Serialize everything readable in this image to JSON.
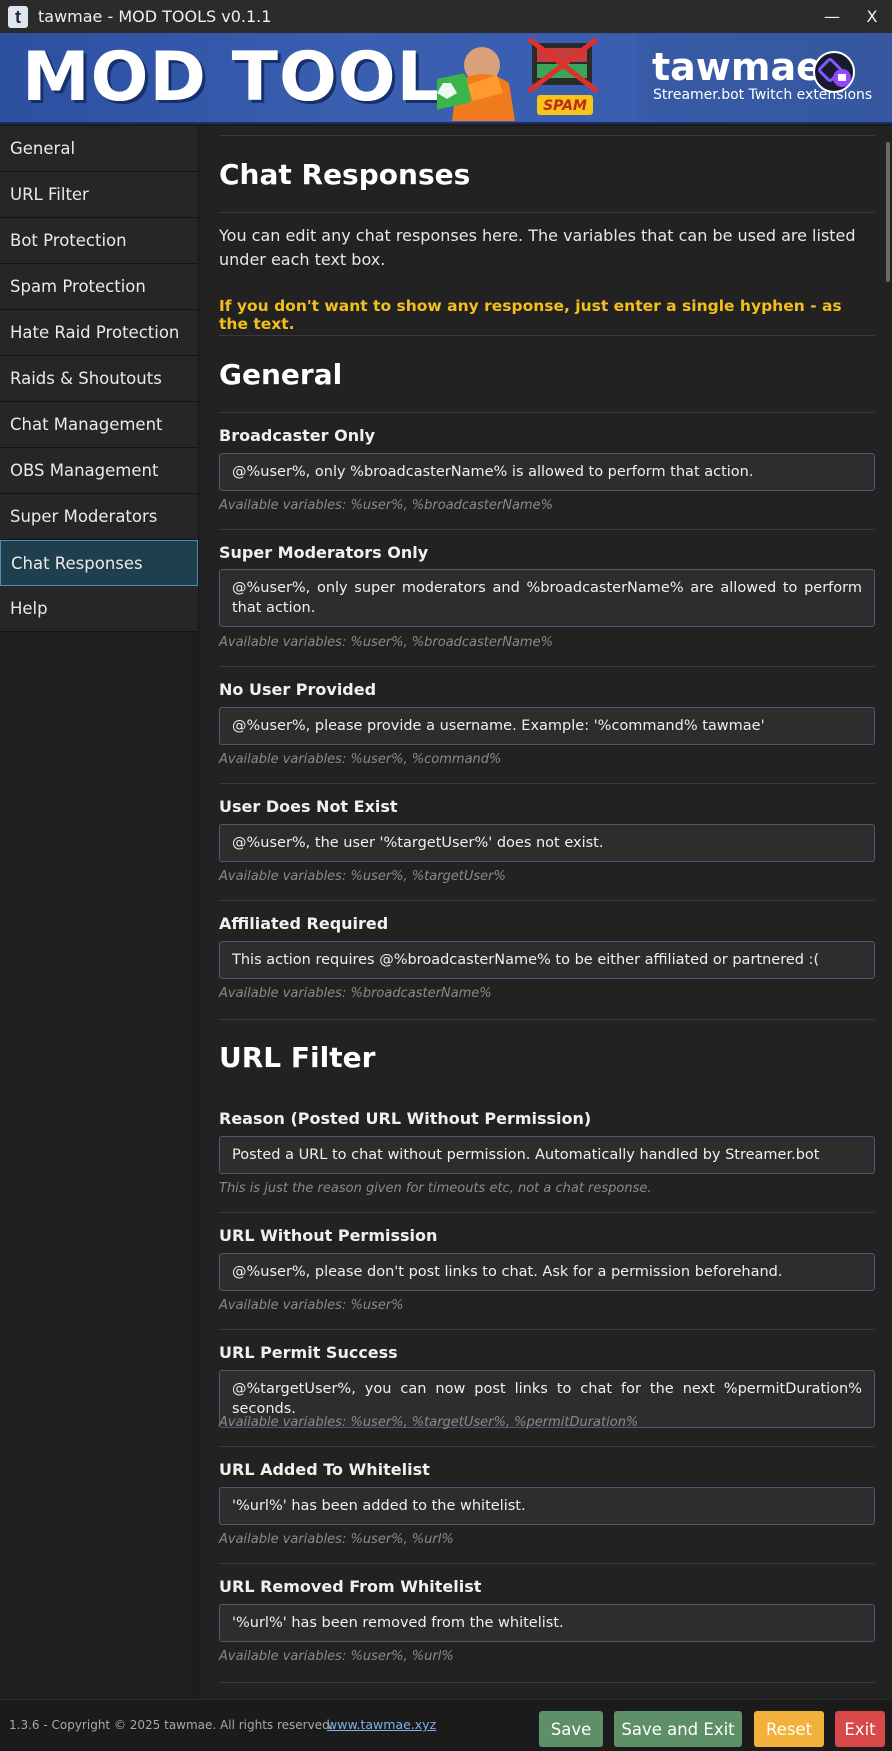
{
  "window": {
    "title": "tawmae - MOD TOOLS v0.1.1",
    "icon_letter": "t",
    "minimize_label": "—",
    "close_label": "X"
  },
  "banner": {
    "title": "MOD TOOLS",
    "brand": "tawmae",
    "subtitle": "Streamer.bot Twitch extensions",
    "art_caption": "SPAM",
    "art_icon": "meme-image-icon",
    "logo_icon": "tawmae-twitch-logo-icon"
  },
  "sidebar": {
    "items": [
      {
        "label": "General"
      },
      {
        "label": "URL Filter"
      },
      {
        "label": "Bot Protection"
      },
      {
        "label": "Spam Protection"
      },
      {
        "label": "Hate Raid Protection"
      },
      {
        "label": "Raids & Shoutouts"
      },
      {
        "label": "Chat Management"
      },
      {
        "label": "OBS Management"
      },
      {
        "label": "Super Moderators"
      },
      {
        "label": "Chat Responses"
      },
      {
        "label": "Help"
      }
    ],
    "active_index": 9
  },
  "page": {
    "title": "Chat Responses",
    "intro": "You can edit any chat responses here. The variables that can be used are listed under each text box.",
    "warning": "If you don't want to show any response, just enter a single hyphen - as the text."
  },
  "sections": {
    "general": {
      "heading": "General",
      "fields": [
        {
          "label": "Broadcaster Only",
          "value": "@%user%, only %broadcasterName% is allowed to perform that action.",
          "hint": "Available variables: %user%, %broadcasterName%"
        },
        {
          "label": "Super Moderators Only",
          "value": "@%user%, only super moderators and %broadcasterName% are allowed to perform that action.",
          "hint": "Available variables: %user%, %broadcasterName%"
        },
        {
          "label": "No User Provided",
          "value": "@%user%, please provide a username. Example: '%command% tawmae'",
          "hint": "Available variables: %user%, %command%"
        },
        {
          "label": "User Does Not Exist",
          "value": "@%user%, the user '%targetUser%' does not exist.",
          "hint": "Available variables: %user%, %targetUser%"
        },
        {
          "label": "Affiliated Required",
          "value": "This action requires @%broadcasterName% to be either affiliated or partnered :(",
          "hint": "Available variables: %broadcasterName%"
        }
      ]
    },
    "url_filter": {
      "heading": "URL Filter",
      "fields": [
        {
          "label": "Reason (Posted URL Without Permission)",
          "value": "Posted a URL to chat without permission. Automatically handled by Streamer.bot",
          "hint": "This is just the reason given for timeouts etc, not a chat response."
        },
        {
          "label": "URL Without Permission",
          "value": "@%user%, please don't post links to chat. Ask for a permission beforehand.",
          "hint": "Available variables: %user%"
        },
        {
          "label": "URL Permit Success",
          "value": "@%targetUser%, you can now post links to chat for the next %permitDuration% seconds.",
          "hint": "Available variables: %user%, %targetUser%, %permitDuration%"
        },
        {
          "label": "URL Added To Whitelist",
          "value": "'%url%' has been added to the whitelist.",
          "hint": "Available variables: %user%, %url%"
        },
        {
          "label": "URL Removed From Whitelist",
          "value": "'%url%' has been removed from the whitelist.",
          "hint": "Available variables: %user%, %url%"
        }
      ]
    }
  },
  "footer": {
    "copyright": "1.3.6 - Copyright © 2025 tawmae. All rights reserved.",
    "link": "www.tawmae.xyz",
    "save": "Save",
    "save_exit": "Save and Exit",
    "reset": "Reset",
    "exit": "Exit"
  },
  "colors": {
    "accent_warning": "#f3bf1f",
    "button_save": "#5d9068",
    "button_reset": "#f2b13a",
    "button_exit": "#d94848",
    "active_nav": "#1f3f4f"
  }
}
